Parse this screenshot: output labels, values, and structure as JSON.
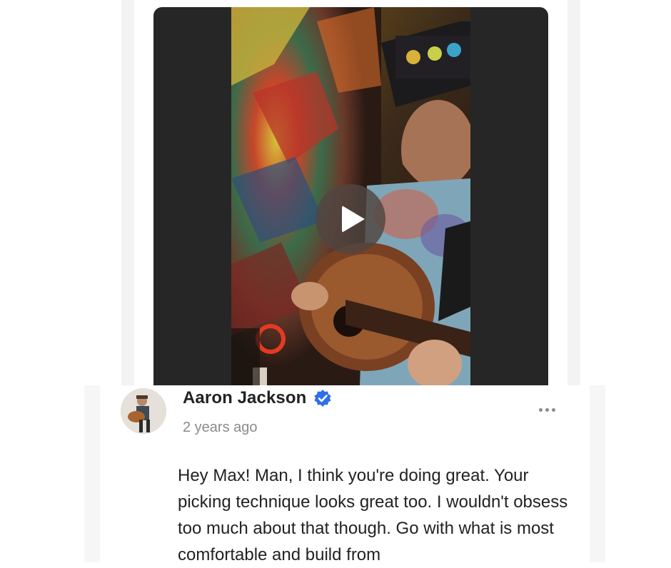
{
  "comment": {
    "author": "Aaron Jackson",
    "timestamp": "2 years ago",
    "verified": true,
    "body": "Hey Max! Man, I think you're doing great. Your picking technique looks great too. I wouldn't obsess too much about that though. Go with what is most comfortable and build from",
    "avatar_icon": "guitarist-avatar",
    "more_icon": "more-options-icon",
    "verified_icon": "verified-badge-icon"
  },
  "video": {
    "play_icon": "play-icon",
    "colors": {
      "letterbox": "#262626",
      "verified": "#2f6fe8"
    }
  }
}
